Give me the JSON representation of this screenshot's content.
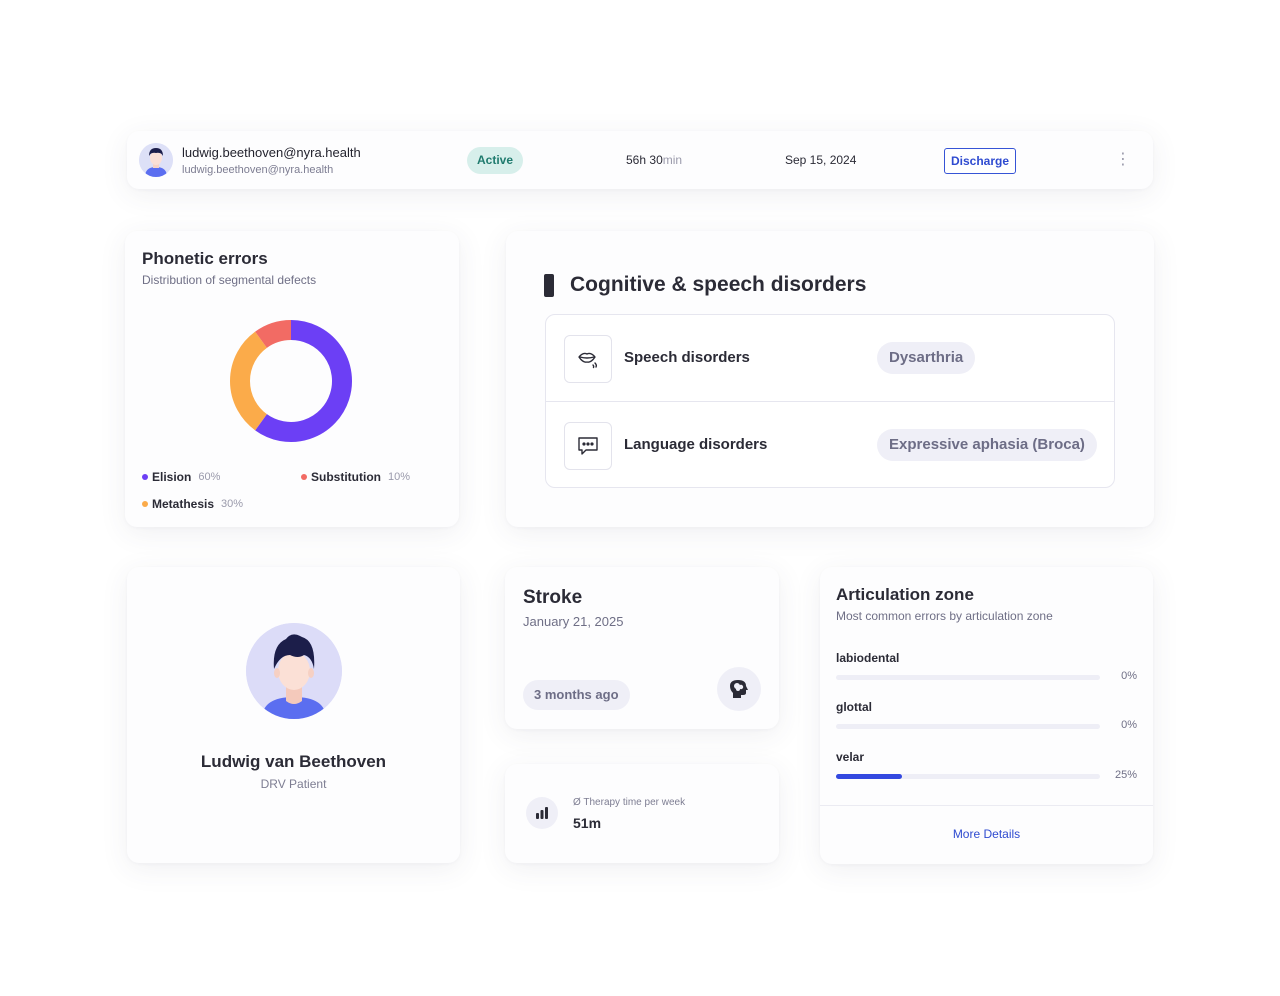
{
  "patient_row": {
    "email_primary": "ludwig.beethoven@nyra.health",
    "email_secondary": "ludwig.beethoven@nyra.health",
    "status": "Active",
    "duration_hours": "56",
    "duration_hours_unit": "h",
    "duration_minutes": "30",
    "duration_minutes_unit": "min",
    "date": "Sep 15, 2024",
    "discharge_label": "Discharge",
    "more_icon": "vertical-dots-icon"
  },
  "phonetic": {
    "title": "Phonetic errors",
    "subtitle": "Distribution of segmental defects"
  },
  "chart_data": {
    "type": "pie",
    "title": "Phonetic errors",
    "subtitle": "Distribution of segmental defects",
    "categories": [
      "Elision",
      "Substitution",
      "Metathesis"
    ],
    "values": [
      60,
      10,
      30
    ],
    "labels": [
      "60%",
      "10%",
      "30%"
    ],
    "colors": [
      "#6c3ff5",
      "#f26b64",
      "#fbab4a"
    ],
    "donut": true,
    "legend": "bottom"
  },
  "cognitive": {
    "title": "Cognitive & speech disorders",
    "items": [
      {
        "name": "Speech disorders",
        "value": "Dysarthria",
        "icon": "lips-speech-icon"
      },
      {
        "name": "Language disorders",
        "value": "Expressive aphasia (Broca)",
        "icon": "speech-bubble-icon"
      }
    ]
  },
  "patient": {
    "name": "Ludwig van Beethoven",
    "role": "DRV Patient"
  },
  "stroke": {
    "title": "Stroke",
    "date": "January 21, 2025",
    "ago": "3 months ago",
    "icon": "brain-head-icon"
  },
  "therapy": {
    "label": "Ø Therapy time per week",
    "value": "51m",
    "icon": "bar-chart-icon"
  },
  "articulation": {
    "title": "Articulation zone",
    "subtitle": "Most common errors by articulation zone",
    "zones": [
      {
        "label": "labiodental",
        "pct_label": "0%",
        "value": 0
      },
      {
        "label": "glottal",
        "pct_label": "0%",
        "value": 0
      },
      {
        "label": "velar",
        "pct_label": "25%",
        "value": 25
      }
    ],
    "more_label": "More Details",
    "accent": "#3349e0"
  }
}
